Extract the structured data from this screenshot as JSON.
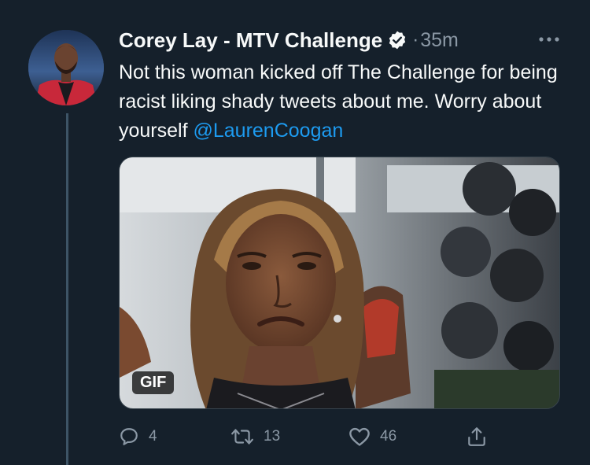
{
  "tweet": {
    "author_name": "Corey Lay - MTV Challenge",
    "separator": "·",
    "time": "35m",
    "text_main": "Not this woman kicked off The Challenge for being racist liking shady tweets about me. Worry about yourself ",
    "mention": "@LaurenCoogan",
    "media_badge": "GIF",
    "replies": "4",
    "retweets": "13",
    "likes": "46"
  },
  "icons": {
    "verified": "verified-badge-icon",
    "more": "more-horizontal-icon",
    "reply": "reply-icon",
    "retweet": "retweet-icon",
    "like": "heart-icon",
    "share": "share-icon"
  },
  "colors": {
    "background": "#15202b",
    "text": "#f7f9f9",
    "secondary": "#8b98a5",
    "accent": "#1d9bf0"
  }
}
